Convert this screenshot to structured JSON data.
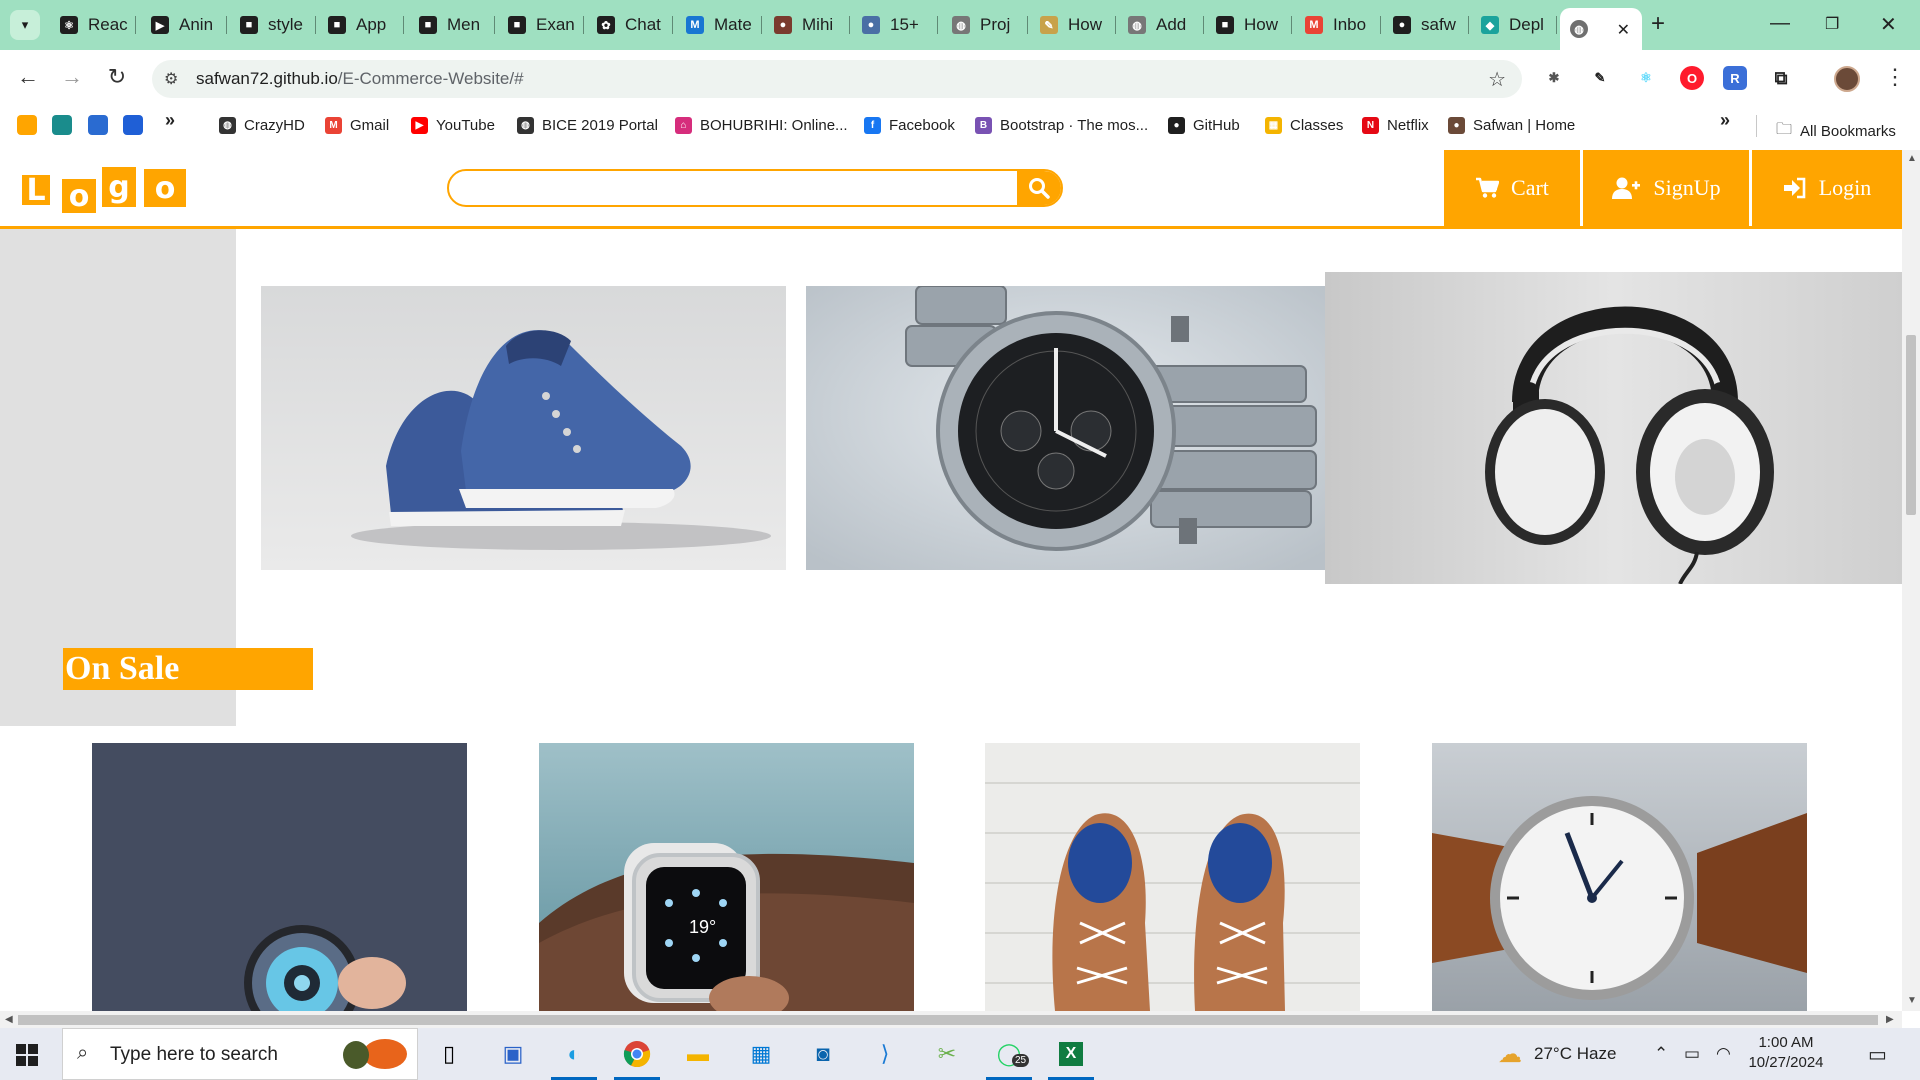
{
  "browser": {
    "tabs": [
      {
        "label": "Reac",
        "icon": "react-icon",
        "color": "#1f1f1f"
      },
      {
        "label": "Anin",
        "icon": "framer-icon",
        "color": "#1f1f1f"
      },
      {
        "label": "style",
        "icon": "page-icon",
        "color": "#1f1f1f"
      },
      {
        "label": "App",
        "icon": "page-icon",
        "color": "#1f1f1f"
      },
      {
        "label": "Men",
        "icon": "page-icon",
        "color": "#1f1f1f"
      },
      {
        "label": "Exan",
        "icon": "page-icon",
        "color": "#1f1f1f"
      },
      {
        "label": "Chat",
        "icon": "chatgpt-icon",
        "color": "#1f1f1f"
      },
      {
        "label": "Mate",
        "icon": "mui-icon",
        "color": "#1976d2"
      },
      {
        "label": "Mihi",
        "icon": "avatar-icon",
        "color": "#7a3b2e"
      },
      {
        "label": "15+",
        "icon": "avatar-icon",
        "color": "#4a6fa5"
      },
      {
        "label": "Proj",
        "icon": "globe-icon",
        "color": "#777777"
      },
      {
        "label": "How",
        "icon": "pen-icon",
        "color": "#c8a24a"
      },
      {
        "label": "Add",
        "icon": "globe-icon",
        "color": "#777777"
      },
      {
        "label": "How",
        "icon": "page-icon",
        "color": "#1f1f1f"
      },
      {
        "label": "Inbo",
        "icon": "gmail-icon",
        "color": "#ea4335"
      },
      {
        "label": "safw",
        "icon": "github-icon",
        "color": "#1f1f1f"
      },
      {
        "label": "Depl",
        "icon": "diamond-icon",
        "color": "#1ba39c"
      }
    ],
    "url_host": "safwan72.github.io",
    "url_path": "/E-Commerce-Website/#",
    "bookmarks": [
      {
        "label": "CrazyHD",
        "color": "#333333"
      },
      {
        "label": "Gmail",
        "color": "#ea4335"
      },
      {
        "label": "YouTube",
        "color": "#ff0000"
      },
      {
        "label": "BICE 2019 Portal",
        "color": "#333333"
      },
      {
        "label": "BOHUBRIHI: Online...",
        "color": "#d62d7c"
      },
      {
        "label": "Facebook",
        "color": "#1877f2"
      },
      {
        "label": "Bootstrap · The mos...",
        "color": "#7952b3"
      },
      {
        "label": "GitHub",
        "color": "#1f1f1f"
      },
      {
        "label": "Classes",
        "color": "#f4b400"
      },
      {
        "label": "Netflix",
        "color": "#e50914"
      },
      {
        "label": "Safwan | Home",
        "color": "#6b4a38"
      }
    ],
    "all_bookmarks": "All Bookmarks"
  },
  "site": {
    "logo_letters": [
      "L",
      "o",
      "g",
      "o"
    ],
    "search_placeholder": "",
    "nav": {
      "cart": "Cart",
      "signup": "SignUp",
      "login": "Login"
    },
    "on_sale_title": "On Sale",
    "accent": "#ffa500",
    "hero_products": [
      "blue sneakers",
      "chronograph wristwatch",
      "headphones"
    ],
    "sale_products": [
      "blue dial watch",
      "smart watch",
      "brown lace-up shoes",
      "leather strap watch"
    ]
  },
  "taskbar": {
    "search_text": "Type here to search",
    "weather": "27°C  Haze",
    "time": "1:00 AM",
    "date": "10/27/2024",
    "whatsapp_badge": "25"
  }
}
